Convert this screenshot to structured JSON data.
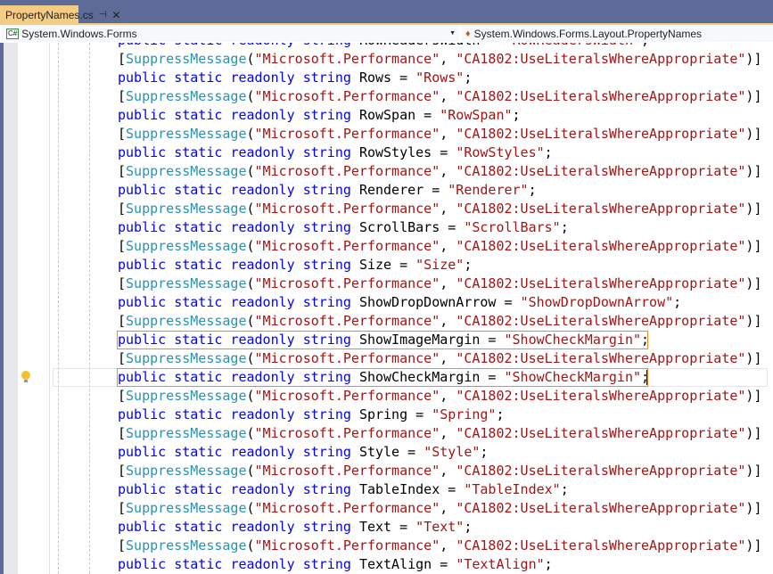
{
  "tab": {
    "title": "PropertyNames.cs",
    "pin_icon": "pin-icon",
    "close_icon": "close-icon"
  },
  "nav": {
    "project": "System.Windows.Forms",
    "type": "System.Windows.Forms.Layout.PropertyNames"
  },
  "code": {
    "kw": [
      "public",
      "static",
      "readonly",
      "string"
    ],
    "attr": "SuppressMessage",
    "attr_arg1": "\"Microsoft.Performance\"",
    "attr_arg2": "\"CA1802:UseLiteralsWhereAppropriate\"",
    "fields": [
      {
        "name": "RowHeadersWidth",
        "value": "\"RowHeadersWidth\""
      },
      {
        "name": "Rows",
        "value": "\"Rows\""
      },
      {
        "name": "RowSpan",
        "value": "\"RowSpan\""
      },
      {
        "name": "RowStyles",
        "value": "\"RowStyles\""
      },
      {
        "name": "Renderer",
        "value": "\"Renderer\""
      },
      {
        "name": "ScrollBars",
        "value": "\"ScrollBars\""
      },
      {
        "name": "Size",
        "value": "\"Size\""
      },
      {
        "name": "ShowDropDownArrow",
        "value": "\"ShowDropDownArrow\""
      },
      {
        "name": "ShowImageMargin",
        "value": "\"ShowCheckMargin\""
      },
      {
        "name": "ShowCheckMargin",
        "value": "\"ShowCheckMargin\""
      },
      {
        "name": "Spring",
        "value": "\"Spring\""
      },
      {
        "name": "Style",
        "value": "\"Style\""
      },
      {
        "name": "TableIndex",
        "value": "\"TableIndex\""
      },
      {
        "name": "Text",
        "value": "\"Text\""
      },
      {
        "name": "TextAlign",
        "value": "\"TextAlign\""
      }
    ]
  },
  "colors": {
    "keyword": "#0000ff",
    "type": "#2b91af",
    "string": "#a31515",
    "highlight": "#f68a1e",
    "tab": "#f5cc84"
  }
}
